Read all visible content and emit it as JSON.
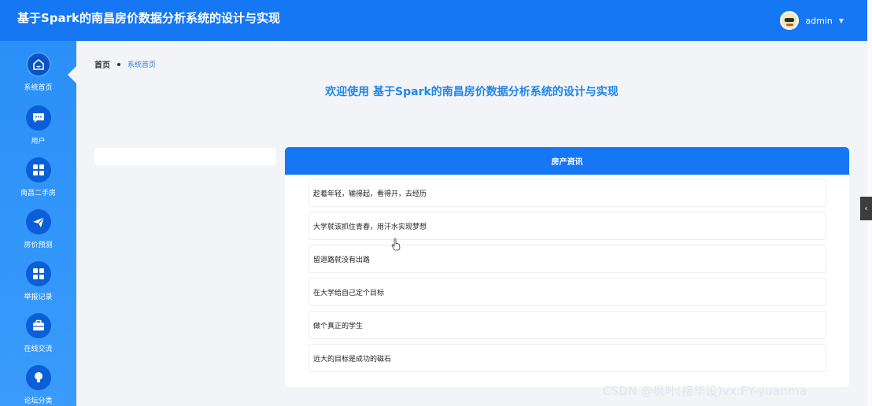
{
  "header": {
    "app_title": "基于Spark的南昌房价数据分析系统的设计与实现",
    "user_name": "admin"
  },
  "sidebar": {
    "items": [
      {
        "label": "系统首页",
        "icon": "home-icon",
        "active": true
      },
      {
        "label": "用户",
        "icon": "chat-icon",
        "active": false
      },
      {
        "label": "南昌二手房",
        "icon": "grid-icon",
        "active": false
      },
      {
        "label": "房价预测",
        "icon": "send-icon",
        "active": false
      },
      {
        "label": "举报记录",
        "icon": "grid-icon",
        "active": false
      },
      {
        "label": "在线交流",
        "icon": "briefcase-icon",
        "active": false
      },
      {
        "label": "论坛分类",
        "icon": "bulb-icon",
        "active": false
      }
    ]
  },
  "breadcrumb": {
    "home": "首页",
    "current": "系统首页"
  },
  "main": {
    "welcome": "欢迎使用 基于Spark的南昌房价数据分析系统的设计与实现",
    "news": {
      "title": "房产资讯",
      "items": [
        "趁着年轻，输得起，看得开，去经历",
        "大学就该抓住青春，用汗水实现梦想",
        "留退路就没有出路",
        "在大学给自己定个目标",
        "做个真正的学生",
        "远大的目标是成功的磁石"
      ]
    }
  },
  "watermark": "CSDN @枫叶(接毕设)vx:FY-yuanma",
  "colors": {
    "primary": "#1677f5",
    "sidebar": "#2a8ff8",
    "icon_bg": "#0a5fd6",
    "welcome_text": "#1f86e8"
  }
}
